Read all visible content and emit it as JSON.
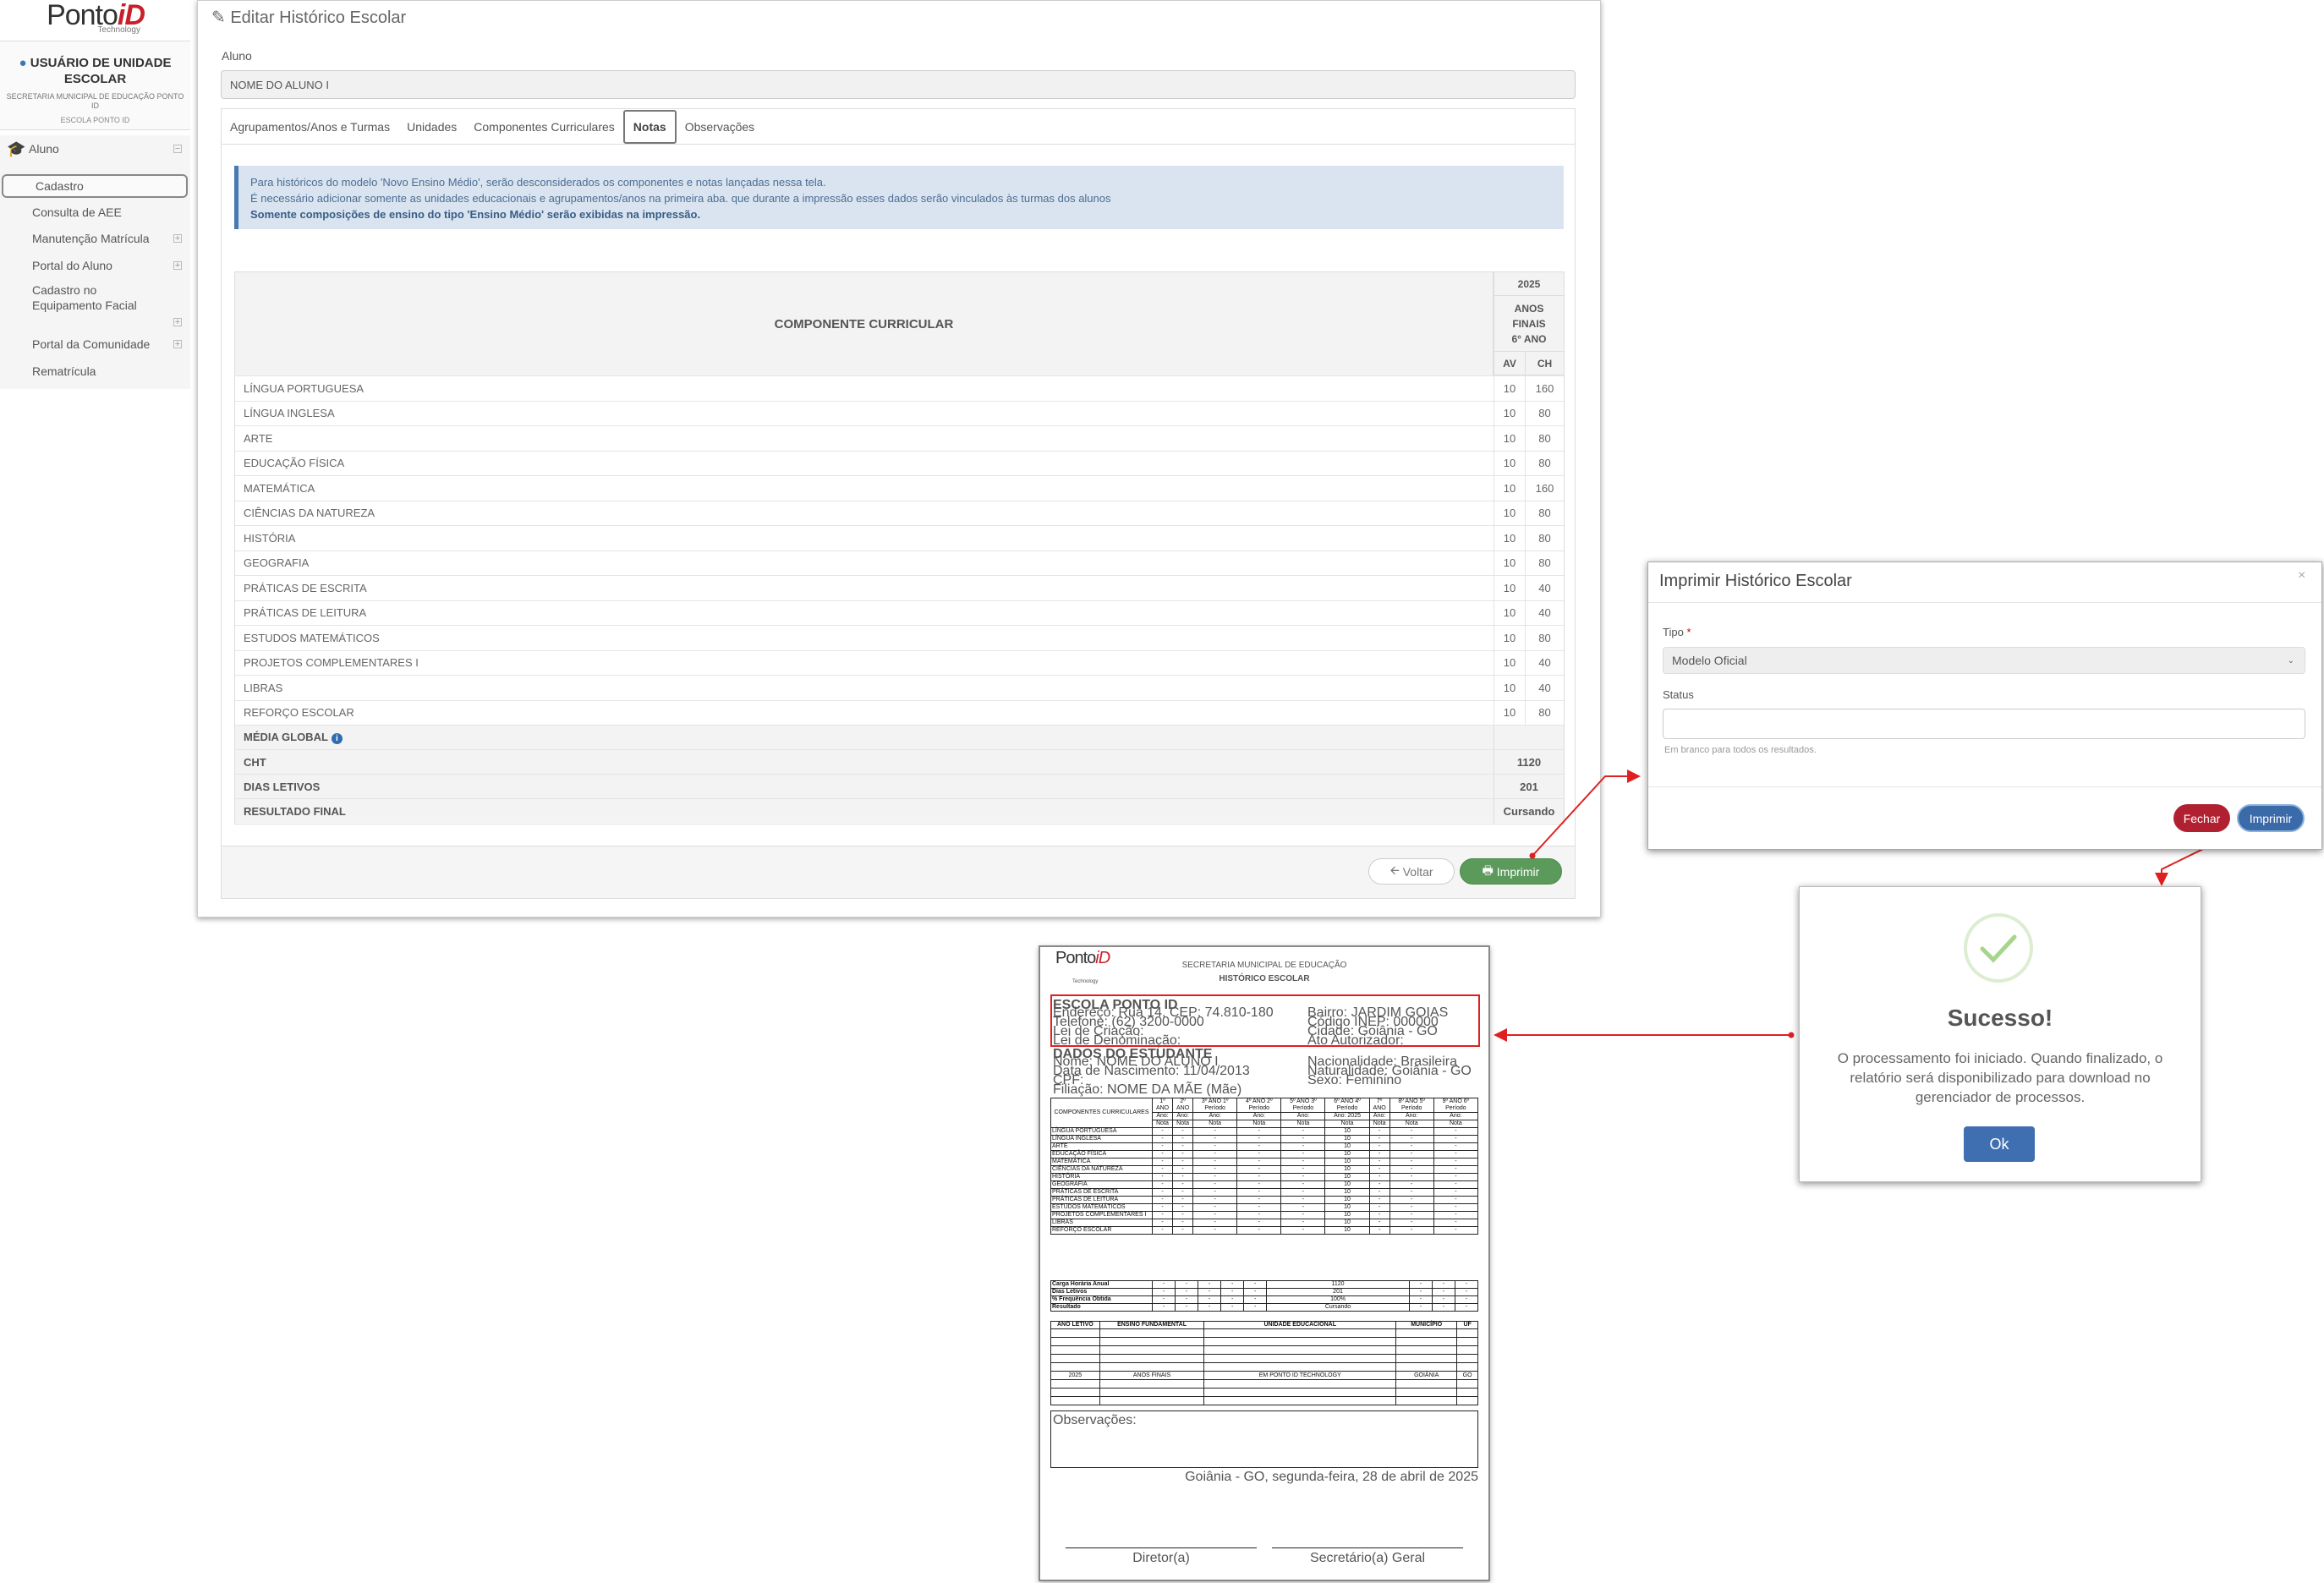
{
  "sidebar": {
    "logo_main": "Ponto",
    "logo_accent": "iD",
    "logo_sub": "Technology",
    "user_title": "USUÁRIO DE UNIDADE ESCOLAR",
    "secretaria": "SECRETARIA MUNICIPAL DE EDUCAÇÃO PONTO ID",
    "escola": "ESCOLA PONTO ID",
    "group_label": "Aluno",
    "items": [
      {
        "label": "Cadastro"
      },
      {
        "label": "Consulta de AEE"
      },
      {
        "label": "Manutenção Matrícula"
      },
      {
        "label": "Portal do Aluno"
      },
      {
        "label": "Cadastro no Equipamento Facial"
      },
      {
        "label": "Portal da Comunidade"
      },
      {
        "label": "Rematrícula"
      }
    ]
  },
  "page": {
    "title": "Editar Histórico Escolar",
    "aluno_label": "Aluno",
    "aluno_value": "NOME DO ALUNO I",
    "tabs": [
      "Agrupamentos/Anos e Turmas",
      "Unidades",
      "Componentes Curriculares",
      "Notas",
      "Observações"
    ],
    "alert_line1": "Para históricos do modelo 'Novo Ensino Médio', serão desconsiderados os componentes e notas lançadas nessa tela.",
    "alert_line2": "É necessário adicionar somente as unidades educacionais e agrupamentos/anos na primeira aba. que durante a impressão esses dados serão vinculados às turmas dos alunos",
    "alert_line3": "Somente composições de ensino do tipo 'Ensino Médio' serão exibidas na impressão.",
    "back_label": "Voltar",
    "print_label": "Imprimir"
  },
  "grades": {
    "header": "COMPONENTE CURRICULAR",
    "year": "2025",
    "level": "ANOS FINAIS 6° ANO",
    "col_av": "AV",
    "col_ch": "CH",
    "rows": [
      {
        "name": "LÍNGUA PORTUGUESA",
        "av": "10",
        "ch": "160"
      },
      {
        "name": "LÍNGUA INGLESA",
        "av": "10",
        "ch": "80"
      },
      {
        "name": "ARTE",
        "av": "10",
        "ch": "80"
      },
      {
        "name": "EDUCAÇÃO FÍSICA",
        "av": "10",
        "ch": "80"
      },
      {
        "name": "MATEMÁTICA",
        "av": "10",
        "ch": "160"
      },
      {
        "name": "CIÊNCIAS DA NATUREZA",
        "av": "10",
        "ch": "80"
      },
      {
        "name": "HISTÓRIA",
        "av": "10",
        "ch": "80"
      },
      {
        "name": "GEOGRAFIA",
        "av": "10",
        "ch": "80"
      },
      {
        "name": "PRÁTICAS DE ESCRITA",
        "av": "10",
        "ch": "40"
      },
      {
        "name": "PRÁTICAS DE LEITURA",
        "av": "10",
        "ch": "40"
      },
      {
        "name": "ESTUDOS MATEMÁTICOS",
        "av": "10",
        "ch": "80"
      },
      {
        "name": "PROJETOS COMPLEMENTARES I",
        "av": "10",
        "ch": "40"
      },
      {
        "name": "LIBRAS",
        "av": "10",
        "ch": "40"
      },
      {
        "name": "REFORÇO ESCOLAR",
        "av": "10",
        "ch": "80"
      }
    ],
    "media_global": "MÉDIA GLOBAL",
    "cht_label": "CHT",
    "cht_value": "1120",
    "dias_label": "DIAS LETIVOS",
    "dias_value": "201",
    "resultado_label": "RESULTADO FINAL",
    "resultado_value": "Cursando"
  },
  "print_modal": {
    "title": "Imprimir Histórico Escolar",
    "close": "×",
    "tipo_label": "Tipo",
    "tipo_required": "*",
    "tipo_value": "Modelo Oficial",
    "status_label": "Status",
    "status_hint": "Em branco para todos os resultados.",
    "fechar": "Fechar",
    "imprimir": "Imprimir"
  },
  "success_modal": {
    "title": "Sucesso!",
    "message": "O processamento foi iniciado. Quando finalizado, o relatório será disponibilizado para download no gerenciador de processos.",
    "ok": "Ok"
  },
  "document": {
    "secretaria": "SECRETARIA MUNICIPAL DE EDUCAÇÃO",
    "title": "HISTÓRICO ESCOLAR",
    "escola": "ESCOLA PONTO ID",
    "endereco": "Endereço: Rua 14, CEP: 74.810-180",
    "telefone": "Telefone: (62) 3200-0000",
    "lei_criacao": "Lei de Criação:",
    "lei_denominacao": "Lei de Denominação:",
    "bairro": "Bairro: JARDIM GOIAS",
    "inep": "Código INEP: 000000",
    "cidade": "Cidade: Goiânia - GO",
    "ato": "Ato Autorizador:",
    "dados": "DADOS DO ESTUDANTE",
    "nome": "Nome: NOME DO ALUNO I",
    "nascimento": "Data de Nascimento: 11/04/2013",
    "cpf": "CPF:",
    "filiacao": "Filiação: NOME DA MÃE (Mãe)",
    "nacionalidade": "Nacionalidade: Brasileira",
    "naturalidade": "Naturalidade: Goiânia - GO",
    "sexo": "Sexo: Feminino",
    "comp_header": "COMPONENTES CURRICULARES",
    "year_cols": [
      "1º ANO",
      "2º ANO",
      "3º ANO 1º Período",
      "4º ANO 2º Período",
      "5º ANO 3º Período",
      "6º ANO 4º Período",
      "7º ANO",
      "8º ANO 5º Período",
      "9º ANO 6º Período"
    ],
    "ano_cols": [
      "Ano:",
      "Ano:",
      "Ano:",
      "Ano:",
      "Ano:",
      "Ano: 2025",
      "Ano:",
      "Ano:",
      "Ano:"
    ],
    "nota": "Nota",
    "dash": "-",
    "subjects": [
      "LÍNGUA PORTUGUESA",
      "LÍNGUA INGLESA",
      "ARTE",
      "EDUCAÇÃO FÍSICA",
      "MATEMÁTICA",
      "CIÊNCIAS DA NATUREZA",
      "HISTÓRIA",
      "GEOGRAFIA",
      "PRÁTICAS DE ESCRITA",
      "PRÁTICAS DE LEITURA",
      "ESTUDOS MATEMÁTICOS",
      "PROJETOS COMPLEMENTARES I",
      "LIBRAS",
      "REFORÇO ESCOLAR"
    ],
    "grade": "10",
    "summary": [
      {
        "label": "Carga Horária Anual",
        "value": "1120"
      },
      {
        "label": "Dias Letivos",
        "value": "201"
      },
      {
        "label": "% Frequência Obtida",
        "value": "100%"
      },
      {
        "label": "Resultado",
        "value": "Cursando"
      }
    ],
    "hist_headers": [
      "ANO LETIVO",
      "ENSINO FUNDAMENTAL",
      "UNIDADE EDUCACIONAL",
      "MUNICÍPIO",
      "UF"
    ],
    "hist_row": [
      "2025",
      "ANOS FINAIS",
      "EM PONTO ID TECHNOLOGY",
      "GOIÂNIA",
      "GO"
    ],
    "observacoes": "Observações:",
    "date": "Goiânia - GO, segunda-feira, 28 de abril de 2025",
    "diretor": "Diretor(a)",
    "secretario": "Secretário(a) Geral"
  }
}
